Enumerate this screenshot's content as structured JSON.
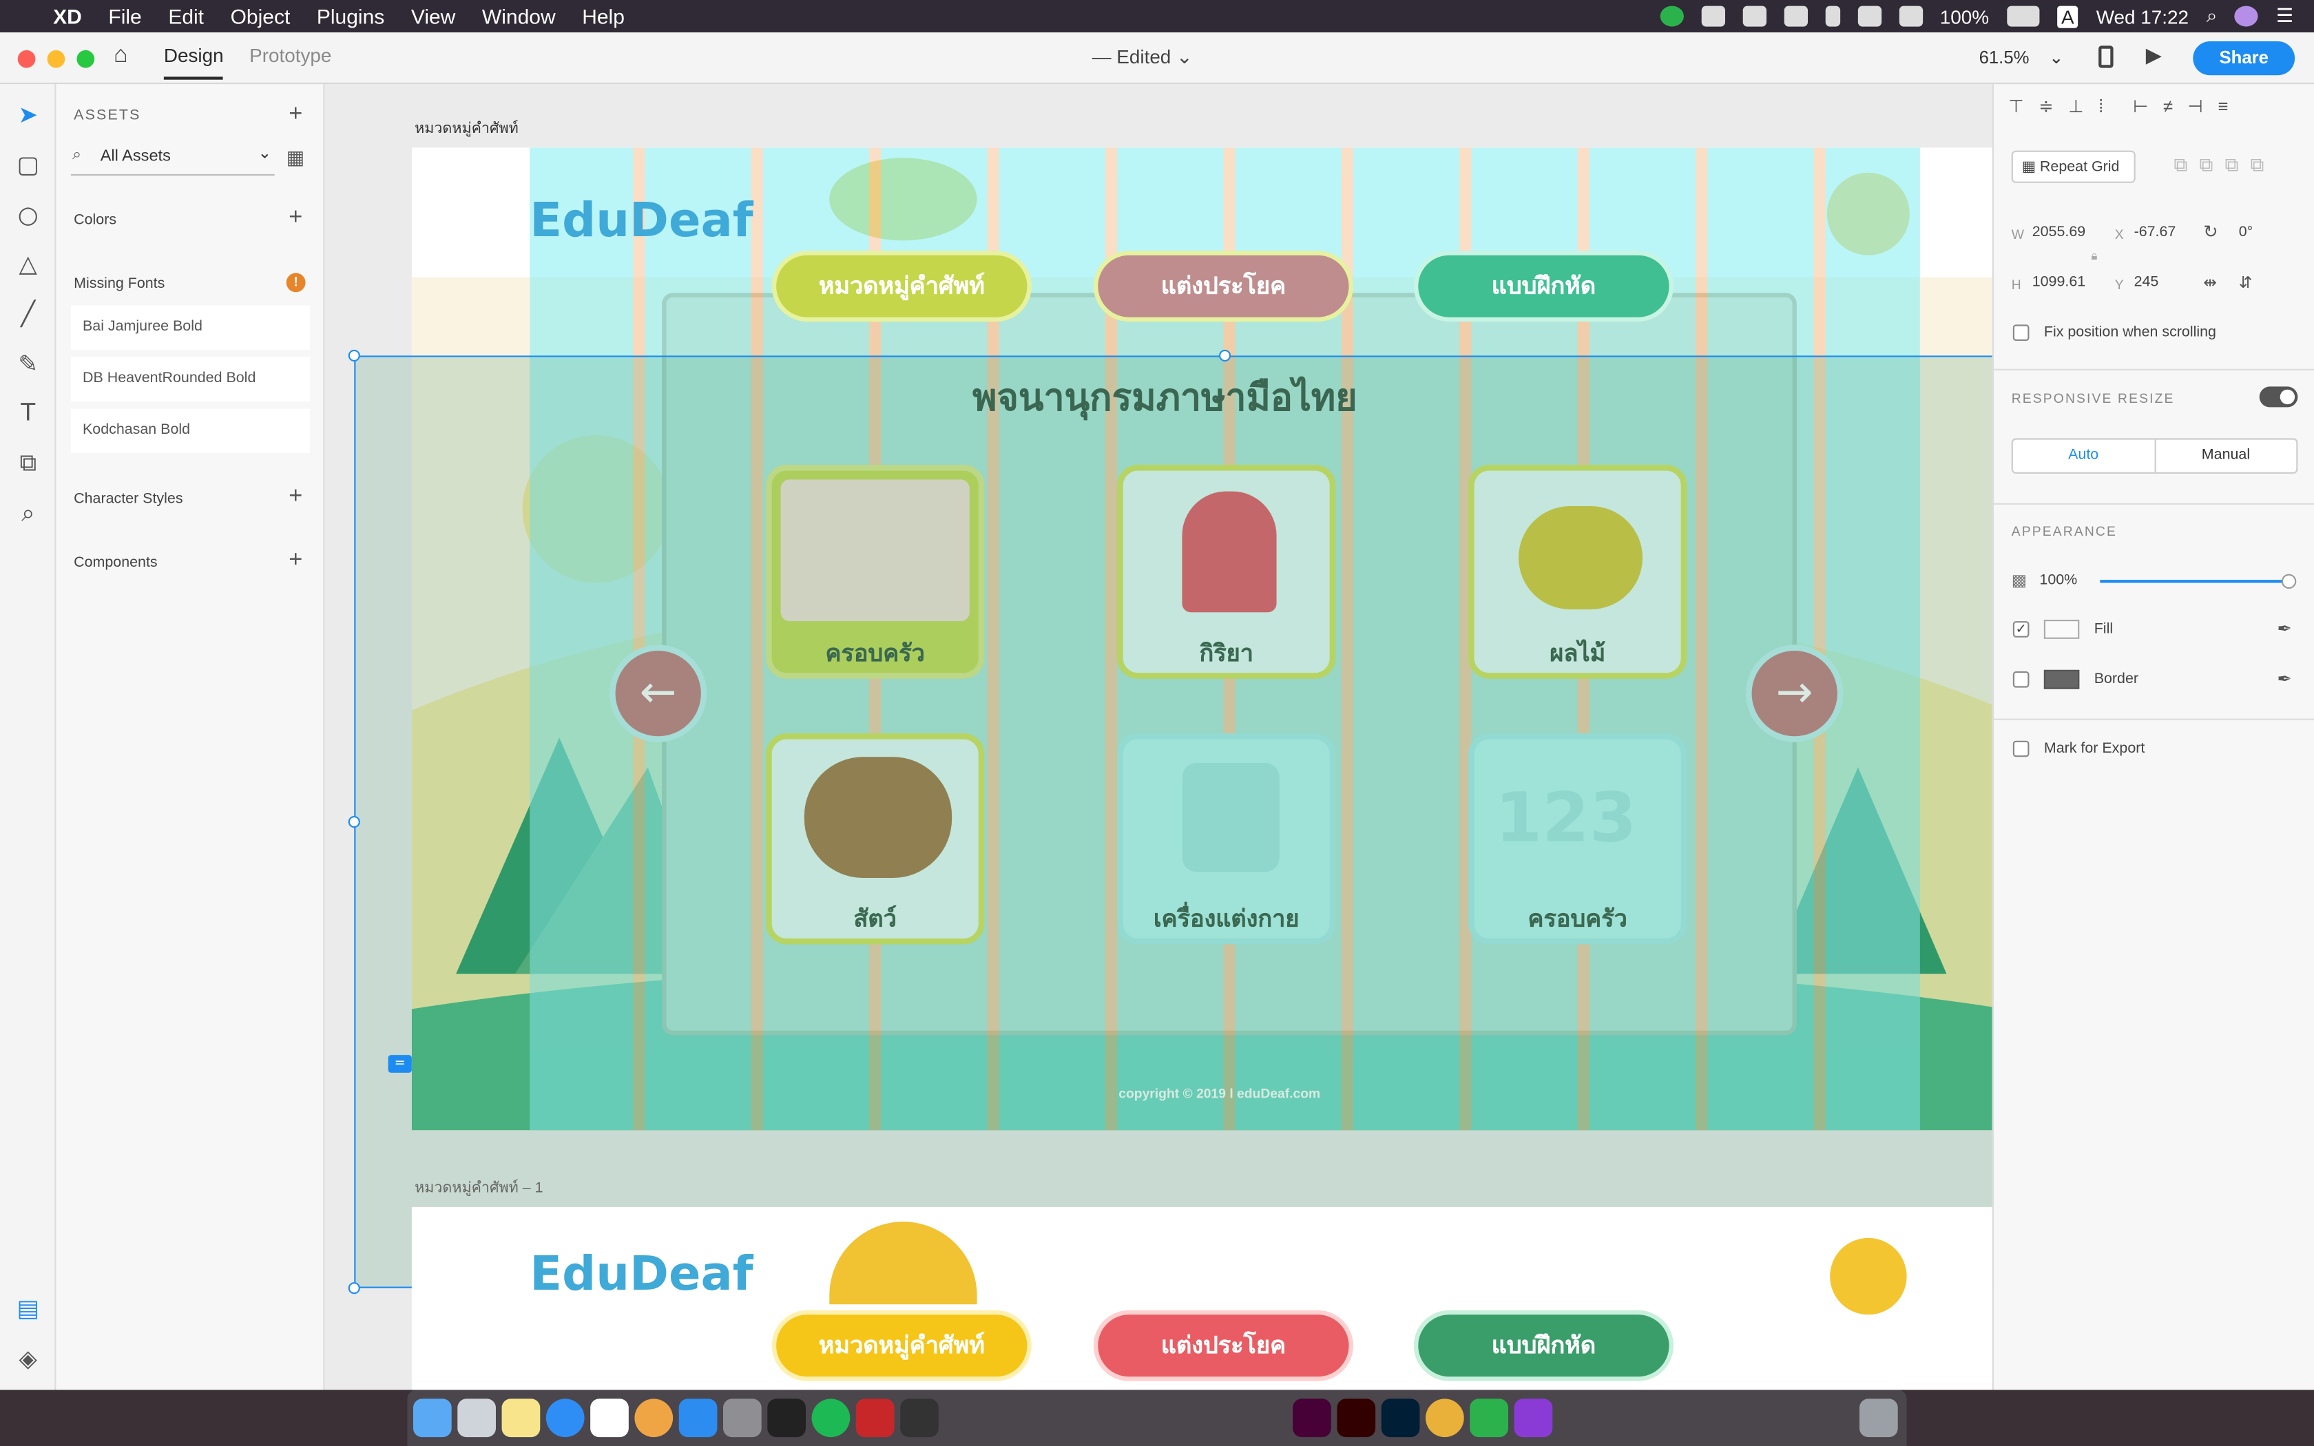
{
  "menubar": {
    "app": "XD",
    "items": [
      "File",
      "Edit",
      "Object",
      "Plugins",
      "View",
      "Window",
      "Help"
    ],
    "battery": "100%",
    "clock": "Wed 17:22",
    "input_source": "A"
  },
  "toolbar": {
    "tab_design": "Design",
    "tab_prototype": "Prototype",
    "doc_title": "— Edited",
    "zoom": "61.5%",
    "share": "Share"
  },
  "assets": {
    "header": "ASSETS",
    "search": "All Assets",
    "colors": "Colors",
    "missing_fonts": "Missing Fonts",
    "fonts": [
      "Bai Jamjuree Bold",
      "DB HeaventRounded Bold",
      "Kodchasan Bold"
    ],
    "character_styles": "Character Styles",
    "components": "Components"
  },
  "artboard": {
    "label": "หมวดหมู่คำศัพท์",
    "label2": "หมวดหมู่คำศัพท์ – 1",
    "logo": "EduDeaf",
    "nav": [
      "หมวดหมู่คำศัพท์",
      "แต่งประโยค",
      "แบบฝึกหัด"
    ],
    "title": "พจนานุกรมภาษามือไทย",
    "cards": [
      "ครอบครัว",
      "กิริยา",
      "ผลไม้",
      "สัตว์",
      "เครื่องแต่งกาย",
      "ครอบครัว"
    ],
    "copyright": "copyright © 2019 l eduDeaf.com"
  },
  "props": {
    "repeat_grid": "Repeat Grid",
    "w_label": "W",
    "w": "2055.69",
    "x_label": "X",
    "x": "-67.67",
    "rotation": "0°",
    "h_label": "H",
    "h": "1099.61",
    "y_label": "Y",
    "y": "245",
    "fix_position": "Fix position when scrolling",
    "responsive_resize": "RESPONSIVE RESIZE",
    "auto": "Auto",
    "manual": "Manual",
    "appearance": "APPEARANCE",
    "opacity": "100%",
    "opacity_value": 1.0,
    "fill": "Fill",
    "border": "Border",
    "mark_export": "Mark for Export"
  },
  "colors": {
    "accent": "#1d8cf2",
    "nav_yellow": "#f5c518",
    "nav_red": "#ea5c63",
    "nav_green": "#3a9e6a",
    "overlay_cyan": "#8df0f4"
  }
}
